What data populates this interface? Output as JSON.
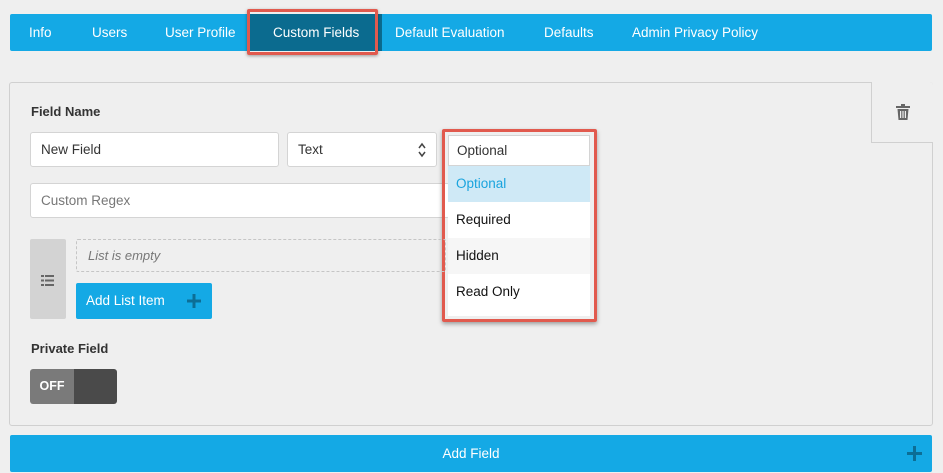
{
  "nav": {
    "tabs": [
      {
        "label": "Info"
      },
      {
        "label": "Users"
      },
      {
        "label": "User Profile"
      },
      {
        "label": "Custom Fields"
      },
      {
        "label": "Default Evaluation"
      },
      {
        "label": "Defaults"
      },
      {
        "label": "Admin Privacy Policy"
      }
    ],
    "active_tab": "Custom Fields"
  },
  "field": {
    "name_label": "Field Name",
    "name_value": "New Field",
    "type_value": "Text",
    "regex_placeholder": "Custom Regex",
    "list_empty_text": "List is empty",
    "add_list_item_label": "Add List Item",
    "private_label": "Private Field",
    "private_toggle": "OFF"
  },
  "visibility_dropdown": {
    "selected": "Optional",
    "options": [
      "Optional",
      "Required",
      "Hidden",
      "Read Only"
    ],
    "highlighted": "Optional"
  },
  "footer": {
    "add_field_label": "Add Field"
  },
  "icons": [
    "trash-icon",
    "list-icon",
    "plus-icon",
    "select-arrows-icon"
  ],
  "colors": {
    "accent": "#14a9e5",
    "active_tab": "#0b6b8f",
    "highlight_border": "#e15a4e",
    "option_selected_bg": "#cfe9f6"
  }
}
